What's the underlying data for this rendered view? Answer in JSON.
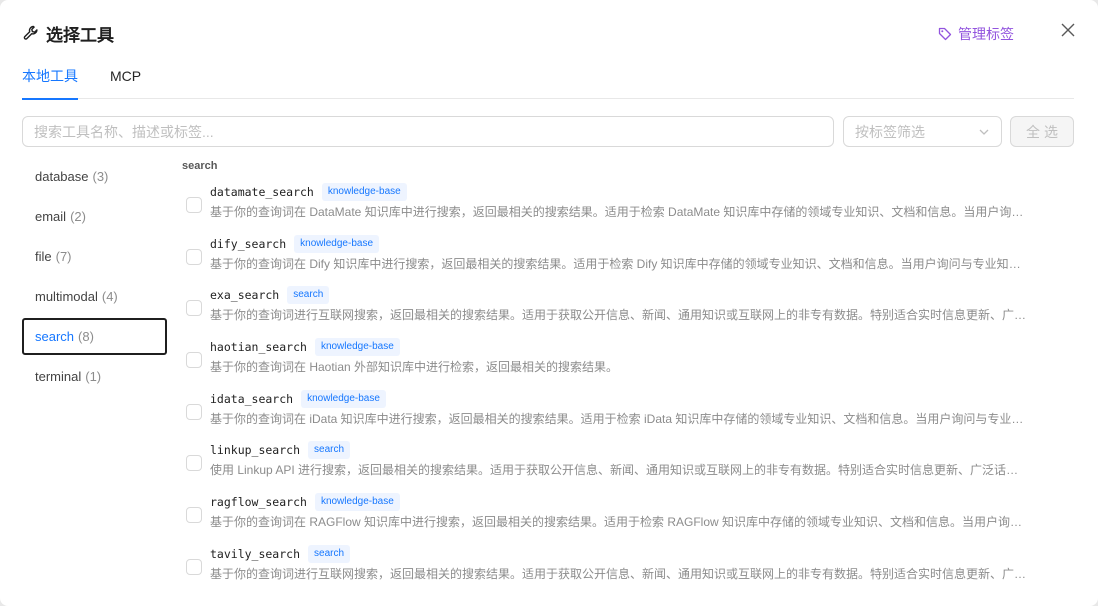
{
  "header": {
    "title": "选择工具",
    "manage_tags_label": "管理标签"
  },
  "tabs": [
    {
      "label": "本地工具",
      "active": true
    },
    {
      "label": "MCP",
      "active": false
    }
  ],
  "search": {
    "placeholder": "搜索工具名称、描述或标签..."
  },
  "tag_filter": {
    "placeholder": "按标签筛选"
  },
  "select_all_label": "全选",
  "sidebar": {
    "items": [
      {
        "label": "database",
        "count": "(3)",
        "active": false
      },
      {
        "label": "email",
        "count": "(2)",
        "active": false
      },
      {
        "label": "file",
        "count": "(7)",
        "active": false
      },
      {
        "label": "multimodal",
        "count": "(4)",
        "active": false
      },
      {
        "label": "search",
        "count": "(8)",
        "active": true
      },
      {
        "label": "terminal",
        "count": "(1)",
        "active": false
      }
    ]
  },
  "main": {
    "group_label": "search",
    "tools": [
      {
        "name": "datamate_search",
        "tag": "knowledge-base",
        "desc": "基于你的查询词在 DataMate 知识库中进行搜索，返回最相关的搜索结果。适用于检索 DataMate 知识库中存储的领域专业知识、文档和信息。当用户询问与专业知识相关的问题时使用"
      },
      {
        "name": "dify_search",
        "tag": "knowledge-base",
        "desc": "基于你的查询词在 Dify 知识库中进行搜索，返回最相关的搜索结果。适用于检索 Dify 知识库中存储的领域专业知识、文档和信息。当用户询问与专业知识相关的问题时使用"
      },
      {
        "name": "exa_search",
        "tag": "search",
        "desc": "基于你的查询词进行互联网搜索，返回最相关的搜索结果。适用于获取公开信息、新闻、通用知识或互联网上的非专有数据。特别适合实时信息更新、广泛话题检索"
      },
      {
        "name": "haotian_search",
        "tag": "knowledge-base",
        "desc": "基于你的查询词在 Haotian 外部知识库中进行检索，返回最相关的搜索结果。"
      },
      {
        "name": "idata_search",
        "tag": "knowledge-base",
        "desc": "基于你的查询词在 iData 知识库中进行搜索，返回最相关的搜索结果。适用于检索 iData 知识库中存储的领域专业知识、文档和信息。当用户询问与专业知识相关的问题时使用"
      },
      {
        "name": "linkup_search",
        "tag": "search",
        "desc": "使用 Linkup API 进行搜索，返回最相关的搜索结果。适用于获取公开信息、新闻、通用知识或互联网上的非专有数据。特别适合实时信息更新、广泛话题检索"
      },
      {
        "name": "ragflow_search",
        "tag": "knowledge-base",
        "desc": "基于你的查询词在 RAGFlow 知识库中进行搜索，返回最相关的搜索结果。适用于检索 RAGFlow 知识库中存储的领域专业知识、文档和信息。当用户询问与专业知识相关的问题时使用"
      },
      {
        "name": "tavily_search",
        "tag": "search",
        "desc": "基于你的查询词进行互联网搜索，返回最相关的搜索结果。适用于获取公开信息、新闻、通用知识或互联网上的非专有数据。特别适合实时信息更新、广泛话题检索"
      }
    ]
  },
  "colors": {
    "accent": "#1677ff",
    "manage_tags": "#9254de"
  }
}
